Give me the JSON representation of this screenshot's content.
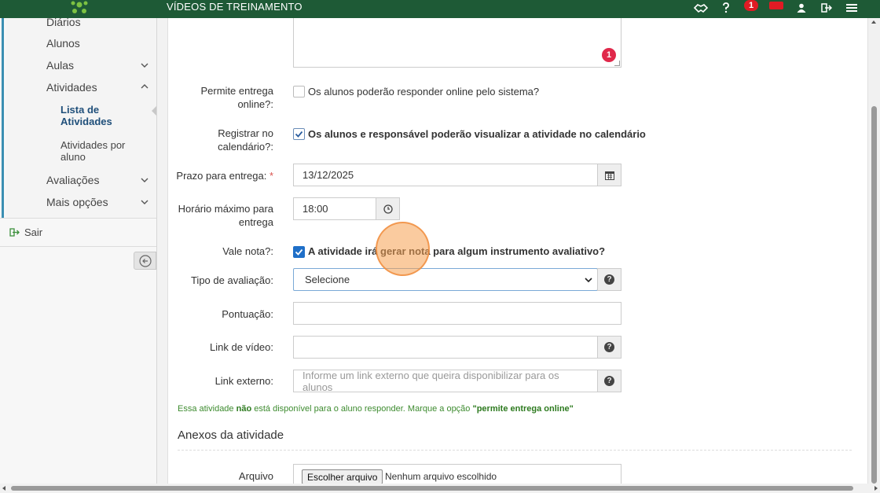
{
  "topbar": {
    "title": "VÍDEOS DE TREINAMENTO",
    "notification_count": "1",
    "icons": [
      "handshake-icon",
      "question-icon",
      "notification-badge",
      "mail-icon",
      "user-icon",
      "logout-icon",
      "menu-icon"
    ]
  },
  "sidebar": {
    "items": [
      {
        "label": "Diários"
      },
      {
        "label": "Alunos"
      },
      {
        "label": "Aulas"
      },
      {
        "label": "Atividades"
      },
      {
        "label": "Avaliações"
      },
      {
        "label": "Mais opções"
      }
    ],
    "sub_items": [
      {
        "label": "Lista de Atividades",
        "active": true
      },
      {
        "label": "Atividades por aluno",
        "active": false
      }
    ],
    "logout_label": "Sair"
  },
  "form": {
    "textarea_badge": "1",
    "online_delivery": {
      "label": "Permite entrega online?:",
      "text": "Os alunos poderão responder online pelo sistema?",
      "checked": false
    },
    "calendar": {
      "label": "Registrar no calendário?:",
      "text": "Os alunos e responsável poderão visualizar a atividade no calendário",
      "checked": true
    },
    "deadline": {
      "label": "Prazo para entrega:",
      "required_mark": "*",
      "value": "13/12/2025"
    },
    "max_time": {
      "label": "Horário máximo para entrega",
      "value": "18:00"
    },
    "grade": {
      "label": "Vale nota?:",
      "text": "A atividade irá gerar nota para algum instrumento avaliativo?",
      "checked": true
    },
    "eval_type": {
      "label": "Tipo de avaliação:",
      "selected": "Selecione"
    },
    "score": {
      "label": "Pontuação:",
      "value": ""
    },
    "video_link": {
      "label": "Link de vídeo:",
      "value": ""
    },
    "external_link": {
      "label": "Link externo:",
      "placeholder": "Informe um link externo que queira disponibilizar para os alunos"
    },
    "notice": {
      "part1": "Essa atividade ",
      "bold1": "não",
      "part2": " está disponível para o aluno responder. Marque a opção ",
      "bold2": "\"permite entrega online\""
    },
    "attachments_title": "Anexos da atividade",
    "file": {
      "label": "Arquivo",
      "button": "Escolher arquivo",
      "status": "Nenhum arquivo escolhido"
    }
  },
  "colors": {
    "topbar": "#1e5a36",
    "accent_blue": "#1f6fc8",
    "notice_green": "#3d8b2f",
    "badge_red": "#e01b24"
  }
}
